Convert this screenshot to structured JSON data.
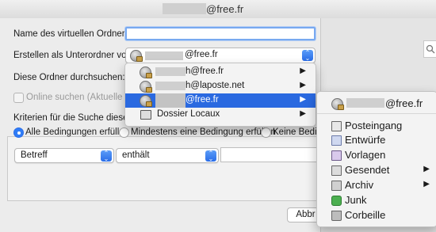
{
  "window": {
    "title": "@free.fr"
  },
  "form": {
    "name_label": "Name des virtuellen Ordners:",
    "name_value": "",
    "parent_label": "Erstellen als Unterordner von:",
    "parent_value": "@free.fr",
    "search_label": "Diese Ordner durchsuchen:",
    "online_label": "Online suchen (Aktuelle Erge",
    "criteria_label": "Kriterien für die Suche dieses v",
    "radio_all": "Alle Bedingungen erfüllen",
    "radio_any": "Mindestens eine Bedingung erfüllen",
    "radio_none": "Keine Bedin",
    "field_value": "Betreff",
    "op_value": "enthält",
    "search_value": "",
    "cancel_label": "Abbr"
  },
  "folder_menu": {
    "items": [
      {
        "label": "h@free.fr",
        "has_submenu": true,
        "selected": false,
        "icon": "globe-icon"
      },
      {
        "label": "h@laposte.net",
        "has_submenu": true,
        "selected": false,
        "icon": "globe-icon"
      },
      {
        "label": "@free.fr",
        "has_submenu": true,
        "selected": true,
        "icon": "globe-lock-icon"
      },
      {
        "label": "Dossier Locaux",
        "has_submenu": true,
        "selected": false,
        "icon": "local-folder-icon"
      }
    ]
  },
  "submenu": {
    "header": "@free.fr",
    "items": [
      {
        "label": "Posteingang",
        "icon": "inbox-icon",
        "has_submenu": false
      },
      {
        "label": "Entwürfe",
        "icon": "drafts-icon",
        "has_submenu": false
      },
      {
        "label": "Vorlagen",
        "icon": "templates-icon",
        "has_submenu": false
      },
      {
        "label": "Gesendet",
        "icon": "sent-icon",
        "has_submenu": true
      },
      {
        "label": "Archiv",
        "icon": "archive-icon",
        "has_submenu": true
      },
      {
        "label": "Junk",
        "icon": "junk-icon",
        "has_submenu": false
      },
      {
        "label": "Corbeille",
        "icon": "trash-icon",
        "has_submenu": false
      }
    ]
  },
  "glyphs": {
    "arrow": "▶",
    "spin": "⌃⌄"
  }
}
